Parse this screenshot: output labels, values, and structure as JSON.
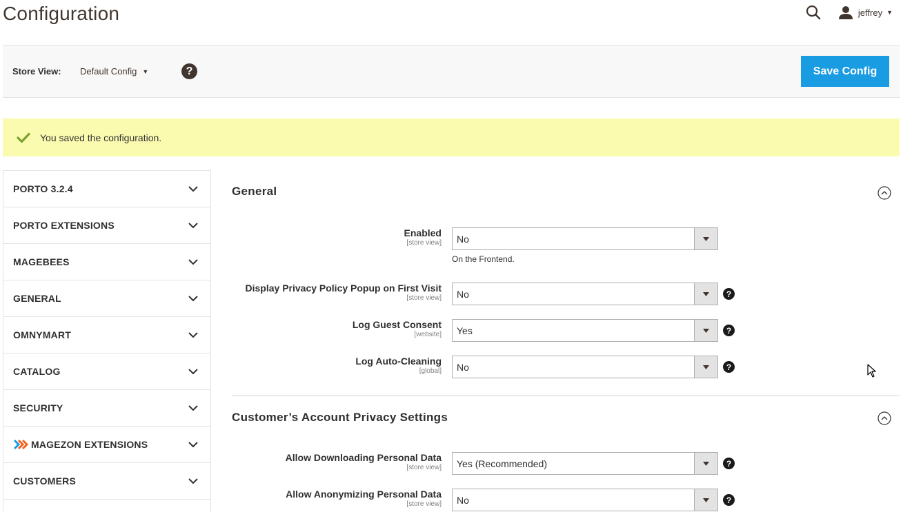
{
  "header": {
    "title": "Configuration",
    "user_name": "jeffrey"
  },
  "toolbar": {
    "store_view_label": "Store View:",
    "store_view_value": "Default Config",
    "save_label": "Save Config"
  },
  "message": {
    "text": "You saved the configuration."
  },
  "sidebar": {
    "items": [
      {
        "label": "PORTO 3.2.4"
      },
      {
        "label": "PORTO EXTENSIONS"
      },
      {
        "label": "MAGEBEES"
      },
      {
        "label": "GENERAL"
      },
      {
        "label": "OMNYMART"
      },
      {
        "label": "CATALOG"
      },
      {
        "label": "SECURITY"
      },
      {
        "label": "MAGEZON EXTENSIONS"
      },
      {
        "label": "CUSTOMERS"
      }
    ]
  },
  "sections": [
    {
      "title": "General",
      "fields": [
        {
          "label": "Enabled",
          "scope": "[store view]",
          "value": "No",
          "note": "On the Frontend."
        },
        {
          "label": "Display Privacy Policy Popup on First Visit",
          "scope": "[store view]",
          "value": "No"
        },
        {
          "label": "Log Guest Consent",
          "scope": "[website]",
          "value": "Yes"
        },
        {
          "label": "Log Auto-Cleaning",
          "scope": "[global]",
          "value": "No"
        }
      ]
    },
    {
      "title": "Customer’s Account Privacy Settings",
      "fields": [
        {
          "label": "Allow Downloading Personal Data",
          "scope": "[store view]",
          "value": "Yes (Recommended)"
        },
        {
          "label": "Allow Anonymizing Personal Data",
          "scope": "[store view]",
          "value": "No"
        }
      ]
    }
  ],
  "colors": {
    "accent": "#1a9ce3",
    "message_bg": "#fbfbb0",
    "success": "#79a22e"
  }
}
